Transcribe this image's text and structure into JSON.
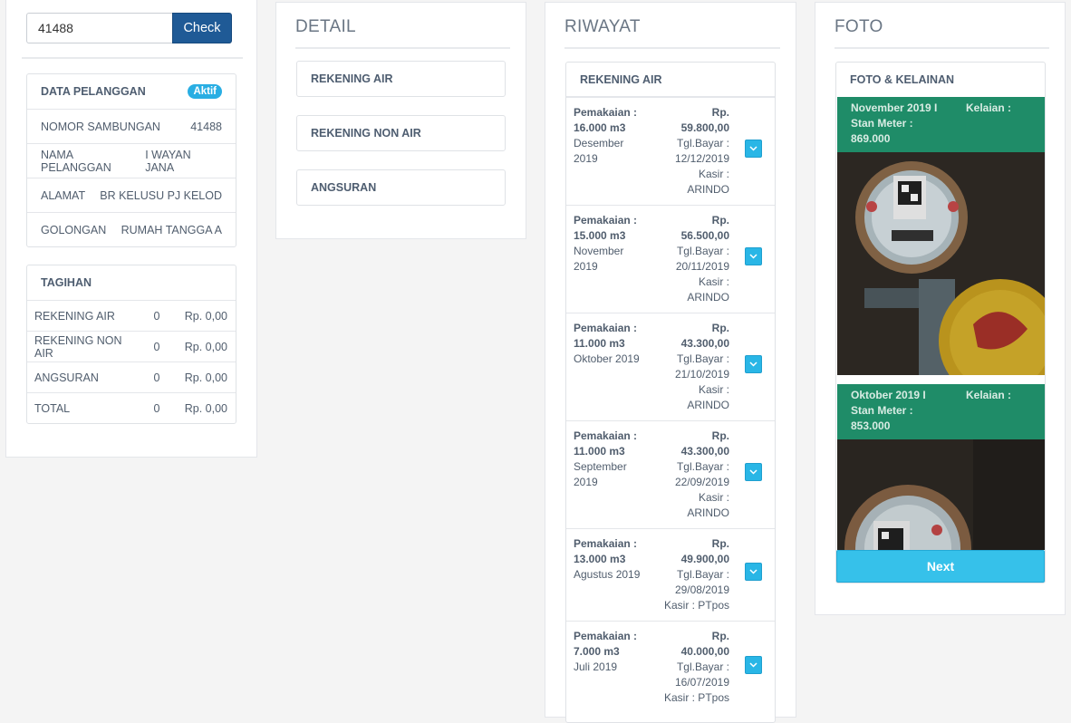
{
  "search": {
    "value": "41488",
    "button": "Check"
  },
  "pelanggan": {
    "title": "DATA PELANGGAN",
    "status": "Aktif",
    "rows": [
      {
        "label": "NOMOR SAMBUNGAN",
        "value": "41488"
      },
      {
        "label": "NAMA PELANGGAN",
        "value": "I WAYAN JANA"
      },
      {
        "label": "ALAMAT",
        "value": "BR KELUSU PJ KELOD"
      },
      {
        "label": "GOLONGAN",
        "value": "RUMAH TANGGA A"
      }
    ]
  },
  "tagihan": {
    "title": "TAGIHAN",
    "rows": [
      {
        "label": "REKENING AIR",
        "count": "0",
        "amount": "Rp. 0,00"
      },
      {
        "label": "REKENING NON AIR",
        "count": "0",
        "amount": "Rp. 0,00"
      },
      {
        "label": "ANGSURAN",
        "count": "0",
        "amount": "Rp. 0,00"
      },
      {
        "label": "TOTAL",
        "count": "0",
        "amount": "Rp. 0,00"
      }
    ]
  },
  "detail": {
    "title": "DETAIL",
    "items": [
      "REKENING AIR",
      "REKENING NON AIR",
      "ANGSURAN"
    ]
  },
  "riwayat": {
    "title": "RIWAYAT",
    "card_title": "REKENING AIR",
    "items": [
      {
        "l1": "Pemakaian :",
        "l2": "16.000 m3",
        "l3": "Desember",
        "l4": "2019",
        "r1": "Rp.",
        "r2": "59.800,00",
        "r3": "Tgl.Bayar :",
        "r4": "12/12/2019",
        "r5": "Kasir :",
        "r6": "ARINDO"
      },
      {
        "l1": "Pemakaian :",
        "l2": "15.000 m3",
        "l3": "November",
        "l4": "2019",
        "r1": "Rp.",
        "r2": "56.500,00",
        "r3": "Tgl.Bayar :",
        "r4": "20/11/2019",
        "r5": "Kasir :",
        "r6": "ARINDO"
      },
      {
        "l1": "Pemakaian :",
        "l2": "11.000 m3",
        "l3": "Oktober 2019",
        "l4": "",
        "r1": "Rp.",
        "r2": "43.300,00",
        "r3": "Tgl.Bayar :",
        "r4": "21/10/2019",
        "r5": "Kasir :",
        "r6": "ARINDO"
      },
      {
        "l1": "Pemakaian :",
        "l2": "11.000 m3",
        "l3": "September",
        "l4": "2019",
        "r1": "Rp.",
        "r2": "43.300,00",
        "r3": "Tgl.Bayar :",
        "r4": "22/09/2019",
        "r5": "Kasir :",
        "r6": "ARINDO"
      },
      {
        "l1": "Pemakaian :",
        "l2": "13.000 m3",
        "l3": "Agustus 2019",
        "l4": "",
        "r1": "Rp.",
        "r2": "49.900,00",
        "r3": "Tgl.Bayar :",
        "r4": "29/08/2019",
        "r5": "Kasir : PTpos",
        "r6": ""
      },
      {
        "l1": "Pemakaian :",
        "l2": "7.000 m3",
        "l3": "Juli 2019",
        "l4": "",
        "r1": "Rp.",
        "r2": "40.000,00",
        "r3": "Tgl.Bayar :",
        "r4": "16/07/2019",
        "r5": "Kasir : PTpos",
        "r6": ""
      }
    ]
  },
  "foto": {
    "title": "FOTO",
    "card_title": "FOTO & KELAINAN",
    "entries": [
      {
        "period": "November 2019 I",
        "kelainan": "Kelaian :",
        "stan_label": "Stan Meter :",
        "stan_value": "869.000"
      },
      {
        "period": "Oktober 2019 I",
        "kelainan": "Kelaian :",
        "stan_label": "Stan Meter :",
        "stan_value": "853.000"
      }
    ],
    "next": "Next"
  },
  "colors": {
    "primary": "#1f5a96",
    "info": "#29b6e6",
    "photo_header": "#1f8c68"
  }
}
